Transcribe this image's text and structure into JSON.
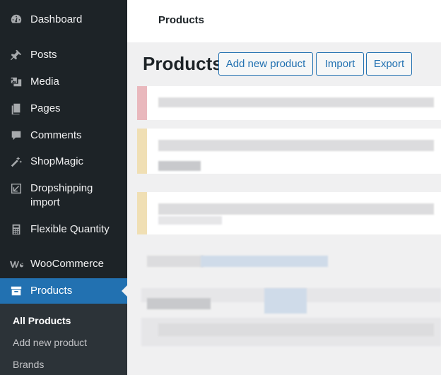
{
  "sidebar": {
    "items": [
      {
        "key": "dashboard",
        "label": "Dashboard",
        "icon": "dashboard-icon"
      },
      {
        "key": "posts",
        "label": "Posts",
        "icon": "pin-icon"
      },
      {
        "key": "media",
        "label": "Media",
        "icon": "media-icon"
      },
      {
        "key": "pages",
        "label": "Pages",
        "icon": "pages-icon"
      },
      {
        "key": "comments",
        "label": "Comments",
        "icon": "comment-icon"
      },
      {
        "key": "shopmagic",
        "label": "ShopMagic",
        "icon": "magic-wand-icon"
      },
      {
        "key": "dropshipping",
        "label": "Dropshipping import",
        "icon": "import-arrow-icon"
      },
      {
        "key": "flexible-quantity",
        "label": "Flexible Quantity",
        "icon": "calculator-icon"
      },
      {
        "key": "woocommerce",
        "label": "WooCommerce",
        "icon": "woocommerce-icon"
      },
      {
        "key": "products",
        "label": "Products",
        "icon": "archive-box-icon",
        "active": true
      }
    ],
    "submenu": [
      {
        "label": "All Products",
        "current": true
      },
      {
        "label": "Add new product"
      },
      {
        "label": "Brands"
      }
    ]
  },
  "topbar": {
    "title": "Products"
  },
  "page": {
    "title": "Products",
    "buttons": [
      "Add new product",
      "Import",
      "Export"
    ]
  },
  "colors": {
    "sidebar_bg": "#1d2327",
    "active_bg": "#2271b1",
    "accent": "#2271b1"
  }
}
